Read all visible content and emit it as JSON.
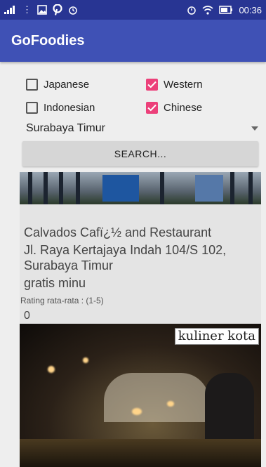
{
  "status_bar": {
    "signal_icon": "signal-icon",
    "clock": "00:36"
  },
  "app_bar": {
    "title": "GoFoodies"
  },
  "filters": {
    "options": [
      {
        "label": "Japanese",
        "checked": false
      },
      {
        "label": "Western",
        "checked": true
      },
      {
        "label": "Indonesian",
        "checked": false
      },
      {
        "label": "Chinese",
        "checked": true
      }
    ],
    "location_selected": "Surabaya Timur"
  },
  "search_button": {
    "label": "SEARCH..."
  },
  "results": [
    {
      "name": "Calvados Cafï¿½ and Restaurant",
      "address": "Jl. Raya Kertajaya Indah 104/S 102, Surabaya Timur",
      "description": "gratis minu",
      "rating_label": "Rating rata-rata : (1-5)",
      "rating_value": "0",
      "photo_watermark": "kuliner kota"
    }
  ],
  "colors": {
    "status_bar": "#283593",
    "app_bar": "#3f51b5",
    "checkbox_checked": "#ec407a",
    "background": "#eeeeee"
  }
}
